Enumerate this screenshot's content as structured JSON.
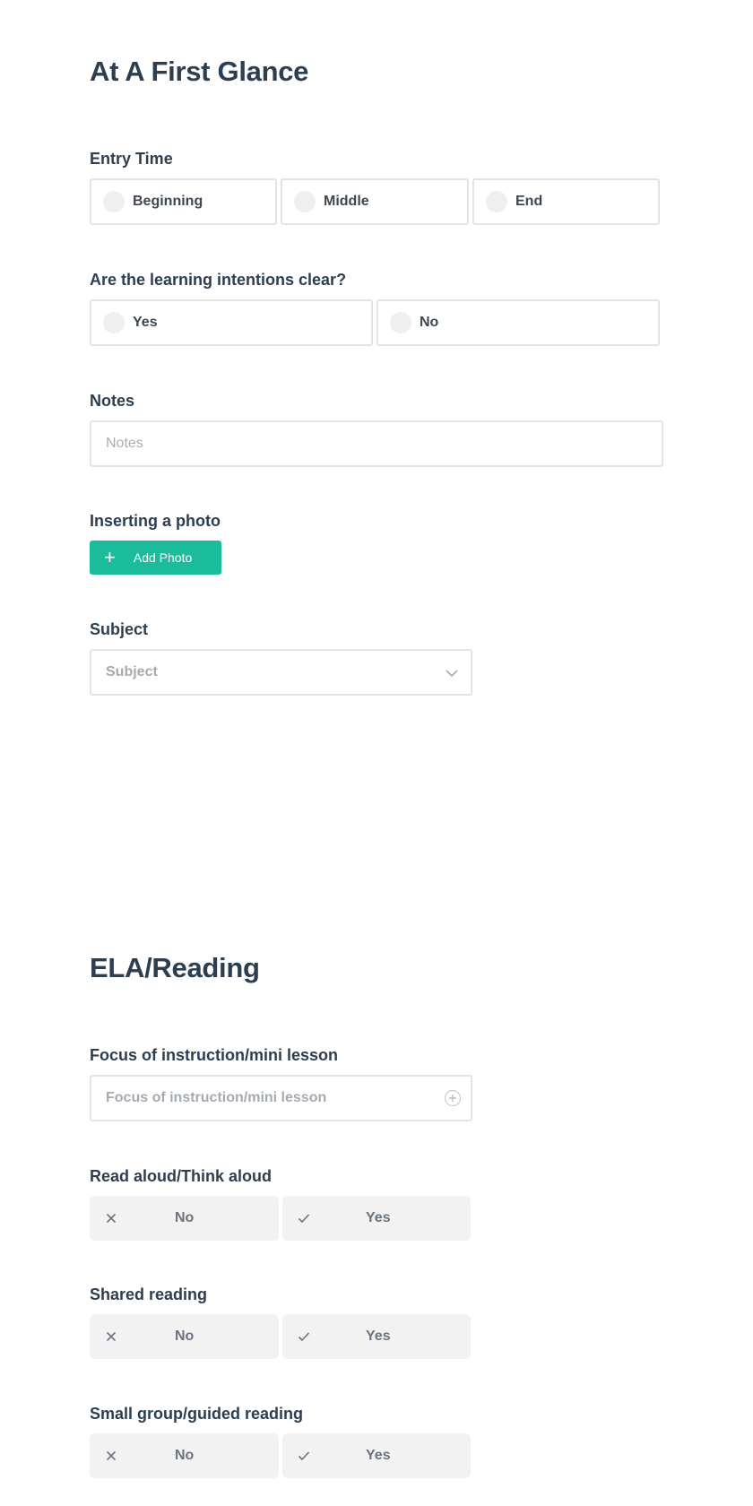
{
  "section1": {
    "title": "At A First Glance",
    "entry_time": {
      "label": "Entry Time",
      "options": [
        "Beginning",
        "Middle",
        "End"
      ],
      "selected": null
    },
    "learning_intentions": {
      "label": "Are the learning intentions clear?",
      "options": [
        "Yes",
        "No"
      ],
      "selected": null
    },
    "notes": {
      "label": "Notes",
      "placeholder": "Notes",
      "value": ""
    },
    "photo": {
      "label": "Inserting a photo",
      "button_icon": "+",
      "button_label": "Add Photo",
      "button_color": "#1abc9c"
    },
    "subject": {
      "label": "Subject",
      "placeholder": "Subject",
      "icon": "chevron-down-icon"
    }
  },
  "section2": {
    "title": "ELA/Reading",
    "focus": {
      "label": "Focus of instruction/mini lesson",
      "placeholder": "Focus of instruction/mini lesson",
      "icon": "add-circle-icon"
    },
    "toggles": [
      {
        "label": "Read aloud/Think aloud",
        "no_label": "No",
        "yes_label": "Yes"
      },
      {
        "label": "Shared reading",
        "no_label": "No",
        "yes_label": "Yes"
      },
      {
        "label": "Small group/guided reading",
        "no_label": "No",
        "yes_label": "Yes"
      }
    ]
  }
}
